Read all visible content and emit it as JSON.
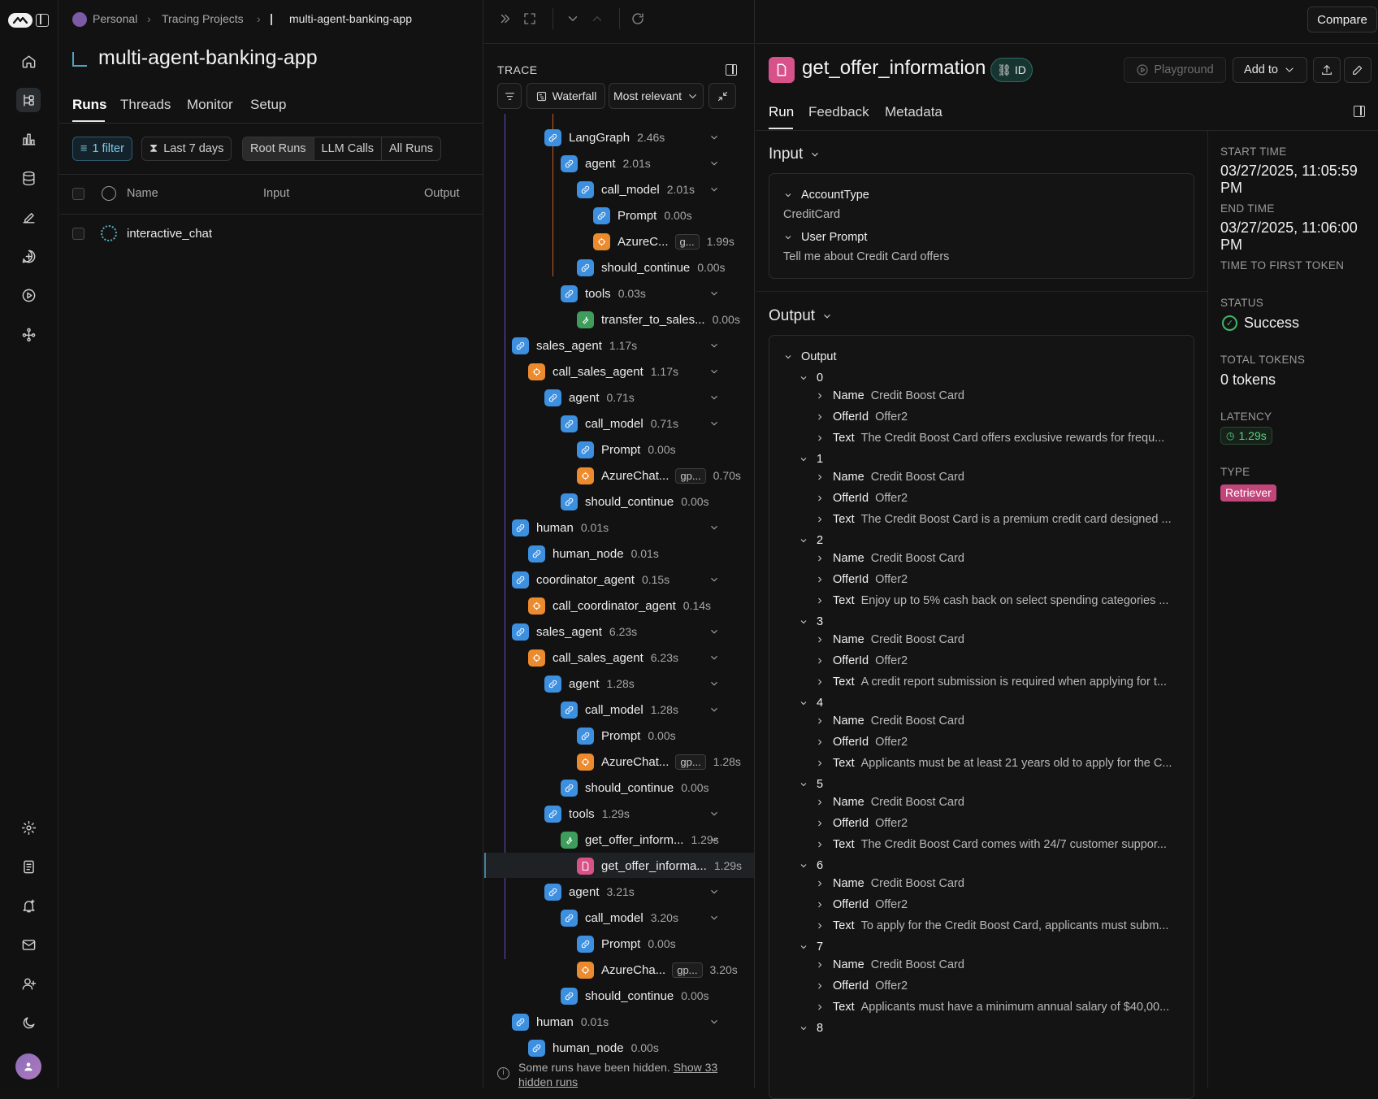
{
  "breadcrumb": {
    "workspace": "Personal",
    "section": "Tracing Projects",
    "project": "multi-agent-banking-app"
  },
  "project_title": "multi-agent-banking-app",
  "project_tabs": [
    "Runs",
    "Threads",
    "Monitor",
    "Setup"
  ],
  "filters": {
    "filter_chip": "1 filter",
    "date_chip": "Last 7 days",
    "run_types": [
      "Root Runs",
      "LLM Calls",
      "All Runs"
    ]
  },
  "runs_table": {
    "columns": [
      "Name",
      "Input",
      "Output"
    ],
    "rows": [
      {
        "name": "interactive_chat"
      }
    ]
  },
  "compare_label": "Compare",
  "trace": {
    "header": "TRACE",
    "view_label": "Waterfall",
    "sort_label": "Most relevant",
    "nodes": [
      {
        "name": "LangGraph",
        "dur": "2.46s",
        "type": "chain",
        "depth": 2,
        "chev": true
      },
      {
        "name": "agent",
        "dur": "2.01s",
        "type": "chain",
        "depth": 3,
        "chev": true
      },
      {
        "name": "call_model",
        "dur": "2.01s",
        "type": "chain",
        "depth": 4,
        "chev": true
      },
      {
        "name": "Prompt",
        "dur": "0.00s",
        "type": "chain",
        "depth": 5,
        "chev": false
      },
      {
        "name": "AzureC...",
        "tag": "g...",
        "dur": "1.99s",
        "type": "llm",
        "depth": 5,
        "chev": false
      },
      {
        "name": "should_continue",
        "dur": "0.00s",
        "type": "chain",
        "depth": 4,
        "chev": false
      },
      {
        "name": "tools",
        "dur": "0.03s",
        "type": "chain",
        "depth": 3,
        "chev": true
      },
      {
        "name": "transfer_to_sales...",
        "dur": "0.00s",
        "type": "tool",
        "depth": 4,
        "chev": false
      },
      {
        "name": "sales_agent",
        "dur": "1.17s",
        "type": "chain",
        "depth": 0,
        "chev": true
      },
      {
        "name": "call_sales_agent",
        "dur": "1.17s",
        "type": "llm",
        "depth": 1,
        "chev": true
      },
      {
        "name": "agent",
        "dur": "0.71s",
        "type": "chain",
        "depth": 2,
        "chev": true
      },
      {
        "name": "call_model",
        "dur": "0.71s",
        "type": "chain",
        "depth": 3,
        "chev": true
      },
      {
        "name": "Prompt",
        "dur": "0.00s",
        "type": "chain",
        "depth": 4,
        "chev": false
      },
      {
        "name": "AzureChat...",
        "tag": "gp...",
        "dur": "0.70s",
        "type": "llm",
        "depth": 4,
        "chev": false
      },
      {
        "name": "should_continue",
        "dur": "0.00s",
        "type": "chain",
        "depth": 3,
        "chev": false
      },
      {
        "name": "human",
        "dur": "0.01s",
        "type": "chain",
        "depth": 0,
        "chev": true
      },
      {
        "name": "human_node",
        "dur": "0.01s",
        "type": "chain",
        "depth": 1,
        "chev": false
      },
      {
        "name": "coordinator_agent",
        "dur": "0.15s",
        "type": "chain",
        "depth": 0,
        "chev": true
      },
      {
        "name": "call_coordinator_agent",
        "dur": "0.14s",
        "type": "llm",
        "depth": 1,
        "chev": false
      },
      {
        "name": "sales_agent",
        "dur": "6.23s",
        "type": "chain",
        "depth": 0,
        "chev": true
      },
      {
        "name": "call_sales_agent",
        "dur": "6.23s",
        "type": "llm",
        "depth": 1,
        "chev": true
      },
      {
        "name": "agent",
        "dur": "1.28s",
        "type": "chain",
        "depth": 2,
        "chev": true
      },
      {
        "name": "call_model",
        "dur": "1.28s",
        "type": "chain",
        "depth": 3,
        "chev": true
      },
      {
        "name": "Prompt",
        "dur": "0.00s",
        "type": "chain",
        "depth": 4,
        "chev": false
      },
      {
        "name": "AzureChat...",
        "tag": "gp...",
        "dur": "1.28s",
        "type": "llm",
        "depth": 4,
        "chev": false
      },
      {
        "name": "should_continue",
        "dur": "0.00s",
        "type": "chain",
        "depth": 3,
        "chev": false
      },
      {
        "name": "tools",
        "dur": "1.29s",
        "type": "chain",
        "depth": 2,
        "chev": true
      },
      {
        "name": "get_offer_inform...",
        "dur": "1.29s",
        "type": "tool",
        "depth": 3,
        "chev": true
      },
      {
        "name": "get_offer_informa...",
        "dur": "1.29s",
        "type": "ret",
        "depth": 4,
        "chev": false,
        "selected": true
      },
      {
        "name": "agent",
        "dur": "3.21s",
        "type": "chain",
        "depth": 2,
        "chev": true
      },
      {
        "name": "call_model",
        "dur": "3.20s",
        "type": "chain",
        "depth": 3,
        "chev": true
      },
      {
        "name": "Prompt",
        "dur": "0.00s",
        "type": "chain",
        "depth": 4,
        "chev": false
      },
      {
        "name": "AzureCha...",
        "tag": "gp...",
        "dur": "3.20s",
        "type": "llm",
        "depth": 4,
        "chev": false
      },
      {
        "name": "should_continue",
        "dur": "0.00s",
        "type": "chain",
        "depth": 3,
        "chev": false
      },
      {
        "name": "human",
        "dur": "0.01s",
        "type": "chain",
        "depth": 0,
        "chev": true
      },
      {
        "name": "human_node",
        "dur": "0.00s",
        "type": "chain",
        "depth": 1,
        "chev": false
      }
    ],
    "hidden_note": "Some runs have been hidden.",
    "hidden_link_a": "Show 33",
    "hidden_link_b": "hidden runs"
  },
  "detail": {
    "title": "get_offer_information",
    "id_badge": "ID",
    "playground_label": "Playground",
    "add_to_label": "Add to",
    "tabs": [
      "Run",
      "Feedback",
      "Metadata"
    ],
    "input_title": "Input",
    "input": [
      {
        "key": "AccountType",
        "value": "CreditCard"
      },
      {
        "key": "User Prompt",
        "value": "Tell me about Credit Card offers"
      }
    ],
    "output_title": "Output",
    "output_root": "Output",
    "items": [
      {
        "idx": "0",
        "name": "Credit Boost Card",
        "offer": "Offer2",
        "text": "The Credit Boost Card offers exclusive rewards for frequ..."
      },
      {
        "idx": "1",
        "name": "Credit Boost Card",
        "offer": "Offer2",
        "text": "The Credit Boost Card is a premium credit card designed ..."
      },
      {
        "idx": "2",
        "name": "Credit Boost Card",
        "offer": "Offer2",
        "text": "Enjoy up to 5% cash back on select spending categories ..."
      },
      {
        "idx": "3",
        "name": "Credit Boost Card",
        "offer": "Offer2",
        "text": "A credit report submission is required when applying for t..."
      },
      {
        "idx": "4",
        "name": "Credit Boost Card",
        "offer": "Offer2",
        "text": "Applicants must be at least 21 years old to apply for the C..."
      },
      {
        "idx": "5",
        "name": "Credit Boost Card",
        "offer": "Offer2",
        "text": "The Credit Boost Card comes with 24/7 customer suppor..."
      },
      {
        "idx": "6",
        "name": "Credit Boost Card",
        "offer": "Offer2",
        "text": "To apply for the Credit Boost Card, applicants must subm..."
      },
      {
        "idx": "7",
        "name": "Credit Boost Card",
        "offer": "Offer2",
        "text": "Applicants must have a minimum annual salary of $40,00..."
      },
      {
        "idx": "8"
      }
    ],
    "keys": {
      "name": "Name",
      "offer": "OfferId",
      "text": "Text"
    },
    "meta": {
      "start_label": "START TIME",
      "start": "03/27/2025, 11:05:59 PM",
      "end_label": "END TIME",
      "end": "03/27/2025, 11:06:00 PM",
      "ttft_label": "TIME TO FIRST TOKEN",
      "status_label": "STATUS",
      "status": "Success",
      "tokens_label": "TOTAL TOKENS",
      "tokens": "0 tokens",
      "latency_label": "LATENCY",
      "latency": "1.29s",
      "type_label": "TYPE",
      "type": "Retriever"
    }
  },
  "colors": {
    "chain": "#3d8fe0",
    "llm": "#ec8a2e",
    "tool": "#3f9d5b",
    "retriever": "#d8528a",
    "success": "#3fb868"
  }
}
